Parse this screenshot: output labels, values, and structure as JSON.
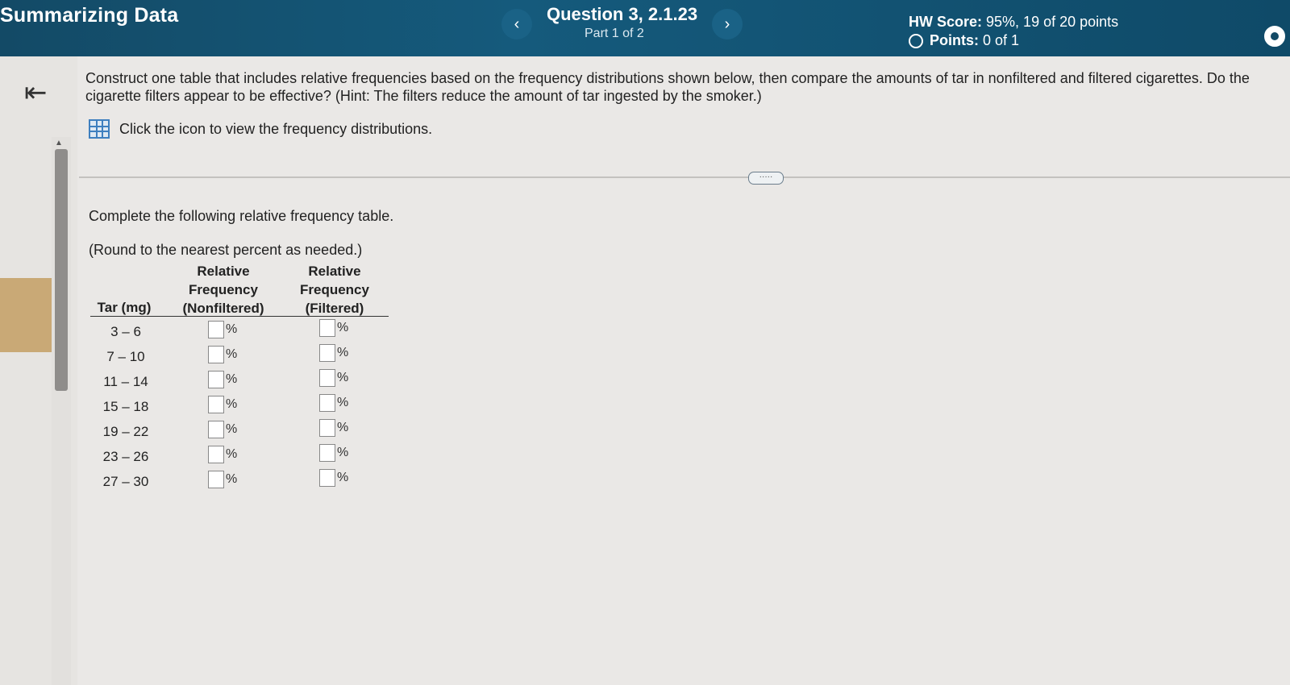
{
  "header": {
    "app_title": "Summarizing Data",
    "prev_icon": "‹",
    "next_icon": "›",
    "question_title": "Question 3, 2.1.23",
    "question_part": "Part 1 of 2",
    "hw_score_label": "HW Score:",
    "hw_score_value": "95%, 19 of 20 points",
    "points_label": "Points:",
    "points_value": "0 of 1"
  },
  "sidebar": {
    "back_icon": "⇤"
  },
  "content": {
    "instructions": "Construct one table that includes relative frequencies based on the frequency distributions shown below, then compare the amounts of tar in nonfiltered and filtered cigarettes. Do the cigarette filters appear to be effective? (Hint: The filters reduce the amount of tar ingested by the smoker.)",
    "view_link": "Click the icon to view the frequency distributions.",
    "more_label": "·····",
    "prompt": "Complete the following relative frequency table.",
    "round_note": "(Round to the nearest percent as needed.)"
  },
  "table": {
    "headers": {
      "tar": "Tar (mg)",
      "nonfiltered": [
        "Relative",
        "Frequency",
        "(Nonfiltered)"
      ],
      "filtered": [
        "Relative",
        "Frequency",
        "(Filtered)"
      ]
    },
    "unit": "%",
    "rows": [
      {
        "range": "3 – 6",
        "nonfiltered": "",
        "filtered": ""
      },
      {
        "range": "7 – 10",
        "nonfiltered": "",
        "filtered": ""
      },
      {
        "range": "11 – 14",
        "nonfiltered": "",
        "filtered": ""
      },
      {
        "range": "15 – 18",
        "nonfiltered": "",
        "filtered": ""
      },
      {
        "range": "19 – 22",
        "nonfiltered": "",
        "filtered": ""
      },
      {
        "range": "23 – 26",
        "nonfiltered": "",
        "filtered": ""
      },
      {
        "range": "27 – 30",
        "nonfiltered": "",
        "filtered": ""
      }
    ]
  },
  "colors": {
    "header_bg": "#134a66",
    "accent": "#3e7fbf",
    "sidebar_tab": "#c9a976",
    "background": "#e6e4e1"
  }
}
